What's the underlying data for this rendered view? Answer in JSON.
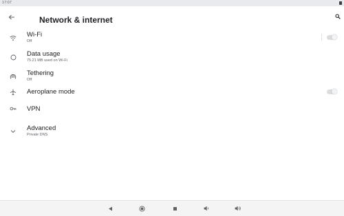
{
  "status_bar": {
    "time": "17:07"
  },
  "header": {
    "title": "Network & internet"
  },
  "settings": {
    "wifi": {
      "title": "Wi-Fi",
      "subtitle": "Off",
      "toggle_on": false
    },
    "data_usage": {
      "title": "Data usage",
      "subtitle": "75.21 MB used on Wi-Fi"
    },
    "tethering": {
      "title": "Tethering",
      "subtitle": "Off"
    },
    "aeroplane_mode": {
      "title": "Aeroplane mode",
      "toggle_on": false
    },
    "vpn": {
      "title": "VPN"
    },
    "advanced": {
      "title": "Advanced",
      "subtitle": "Private DNS"
    }
  },
  "nav_bar": {
    "buttons": [
      "back-icon",
      "home-icon",
      "recents-icon",
      "volume-down-icon",
      "volume-up-icon"
    ]
  },
  "colors": {
    "icon": "#5f6368",
    "text": "#202124",
    "secondary_text": "#5f6368"
  }
}
